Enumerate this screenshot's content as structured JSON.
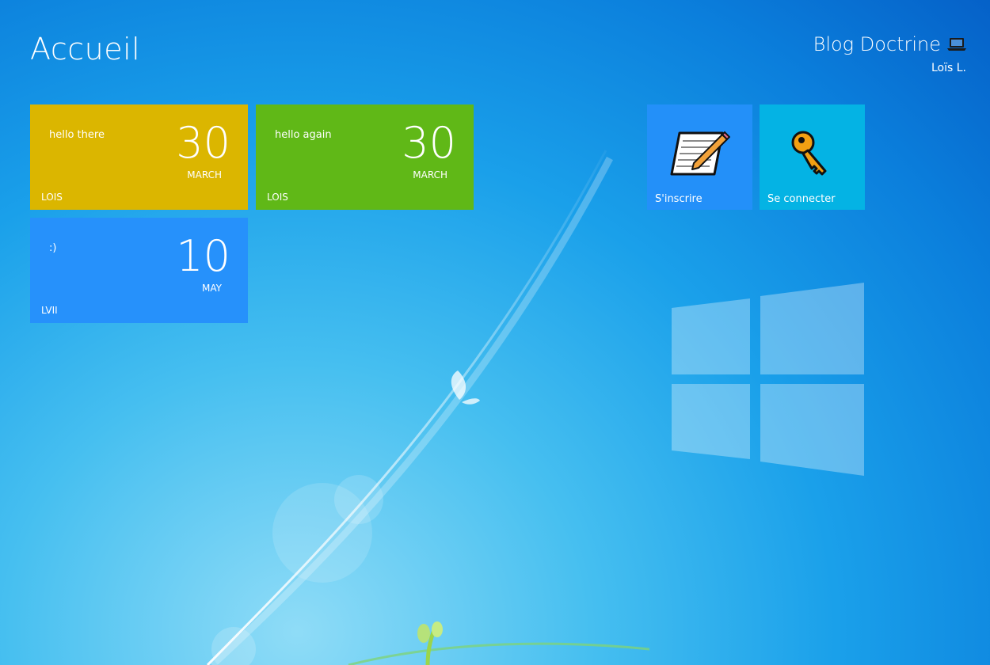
{
  "header": {
    "title": "Accueil",
    "site_name": "Blog Doctrine",
    "site_icon": "laptop-icon",
    "user_name": "Loïs L."
  },
  "posts": [
    {
      "message": "hello there",
      "day": "30",
      "month": "MARCH",
      "author": "LOIS",
      "color": "#dbb600"
    },
    {
      "message": "hello again",
      "day": "30",
      "month": "MARCH",
      "author": "LOIS",
      "color": "#60b817"
    },
    {
      "message": ":)",
      "day": "10",
      "month": "MAY",
      "author": "LVII",
      "color": "#2691fb"
    }
  ],
  "actions": [
    {
      "label": "S'inscrire",
      "icon": "notepad-pencil-icon",
      "color": "#2390f9"
    },
    {
      "label": "Se connecter",
      "icon": "key-icon",
      "color": "#04b3e4"
    }
  ],
  "colors": {
    "background_top": "#0561c8",
    "background_light": "#8fdcf7"
  }
}
